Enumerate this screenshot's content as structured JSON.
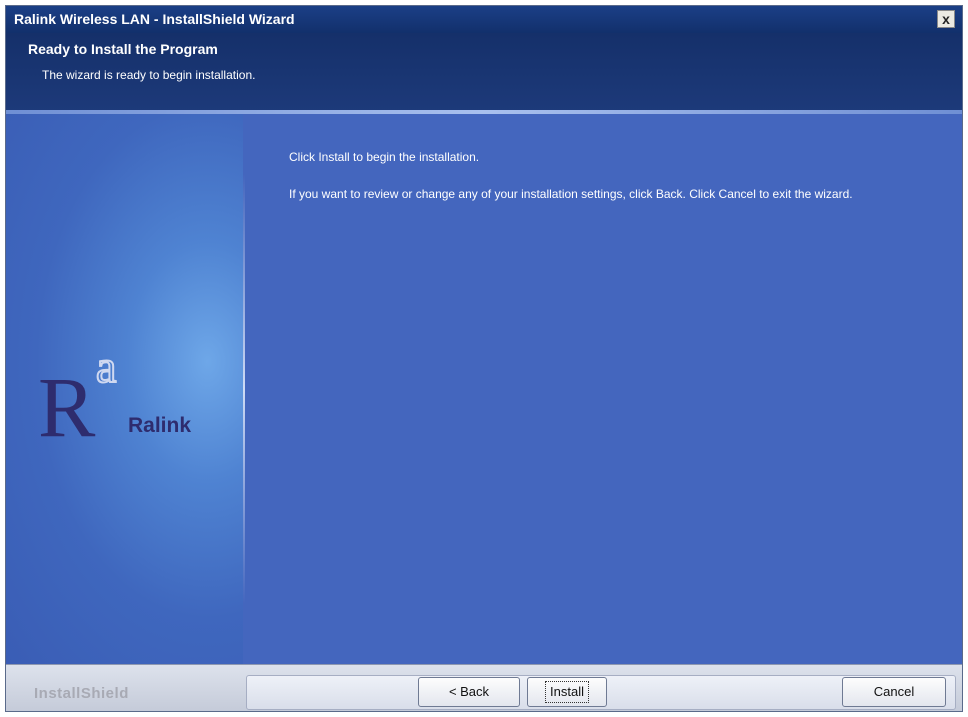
{
  "window": {
    "title": "Ralink Wireless LAN - InstallShield Wizard",
    "close_label": "x"
  },
  "header": {
    "title": "Ready to Install the Program",
    "subtitle": "The wizard is ready to begin installation."
  },
  "content": {
    "line1": "Click Install to begin the installation.",
    "line2": "If you want to review or change any of your installation settings, click Back. Click Cancel to exit the wizard."
  },
  "logo": {
    "text": "Ralink",
    "letter_upper": "R",
    "letter_lower": "a"
  },
  "footer": {
    "brand": "InstallShield",
    "back_label": "< Back",
    "install_label": "Install",
    "cancel_label": "Cancel"
  },
  "colors": {
    "title_bar": "#12306c",
    "main_background": "#4466be",
    "logo_dark": "#2e2c6e",
    "footer_background": "#c5cbd9"
  }
}
